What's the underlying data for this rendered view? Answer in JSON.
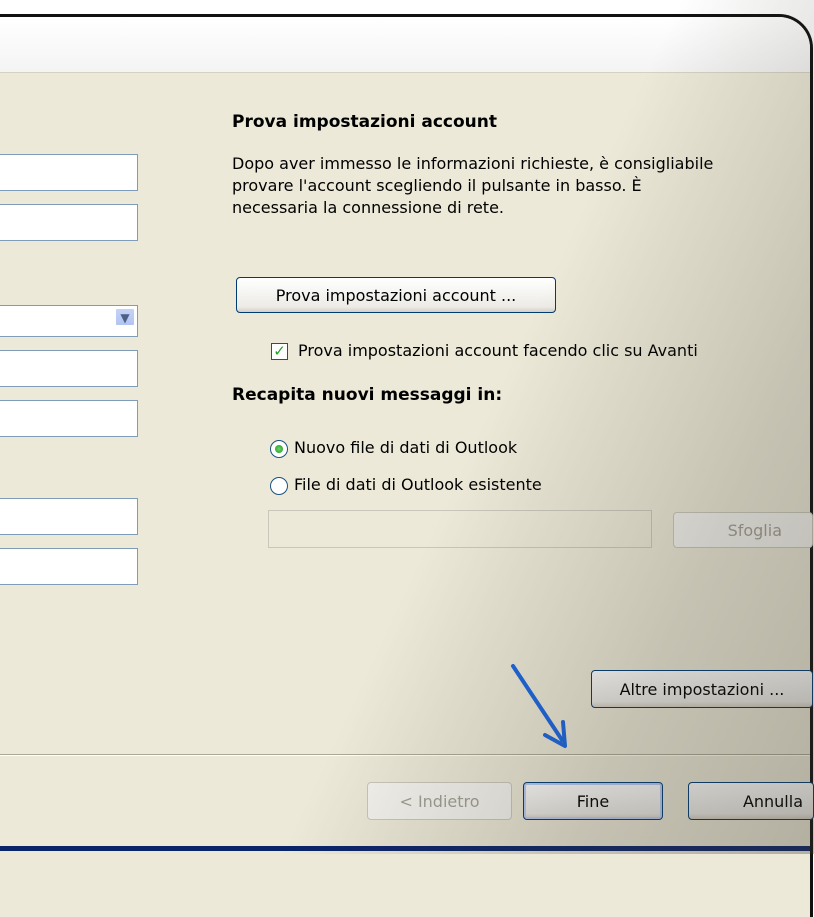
{
  "section": {
    "test_title": "Prova impostazioni account",
    "test_description_lines": [
      "Dopo aver immesso le informazioni richieste, è consigliabile",
      "provare l'account scegliendo il pulsante in basso. È",
      "necessaria la connessione di rete."
    ],
    "test_button": "Prova impostazioni account ...",
    "test_on_next_checkbox": {
      "label": "Prova impostazioni account facendo clic su Avanti",
      "checked": true
    },
    "deliver_title": "Recapita nuovi messaggi in:",
    "deliver_options": [
      {
        "label": "Nuovo file di dati di Outlook",
        "selected": true
      },
      {
        "label": "File di dati di Outlook esistente",
        "selected": false
      }
    ],
    "existing_file_path": "",
    "browse_button": "Sfoglia",
    "more_settings_button": "Altre impostazioni ..."
  },
  "footer": {
    "back_button": "< Indietro",
    "finish_button": "Fine",
    "cancel_button": "Annulla"
  },
  "left_fields": [
    "",
    "",
    "",
    "",
    "",
    "",
    "",
    ""
  ],
  "icons": {
    "combo_arrow": "chevron-down-icon",
    "pointer_arrow": "arrow-icon"
  },
  "colors": {
    "accent": "#0a246a",
    "pointer": "#1a66e0",
    "check": "#21a121"
  }
}
